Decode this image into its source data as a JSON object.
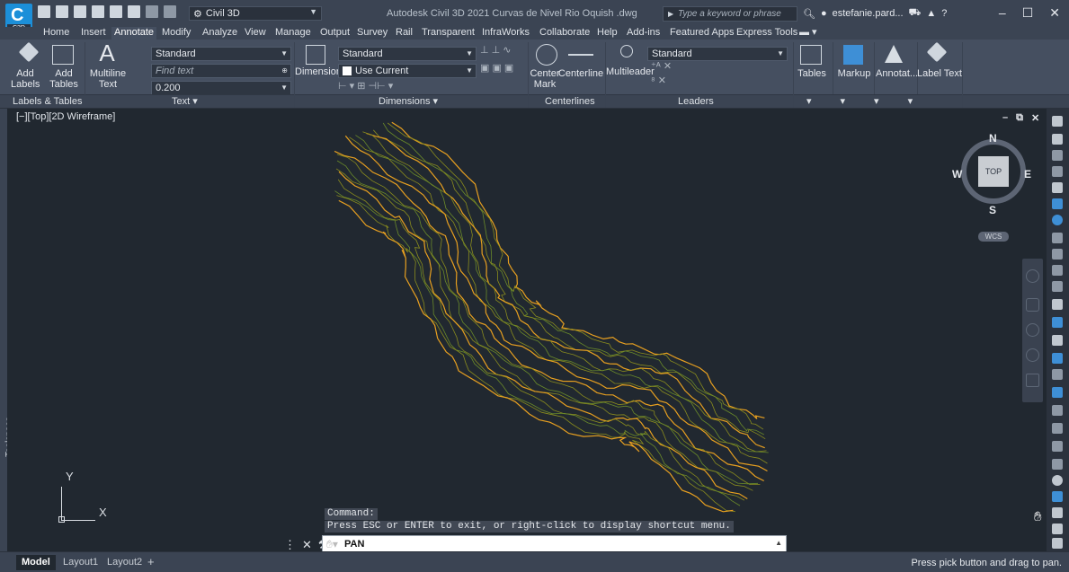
{
  "app": {
    "logo_text": "C",
    "logo_sub": "C3D",
    "workspace": "Civil 3D",
    "title": "Autodesk Civil 3D 2021   Curvas de Nivel Rio Oquish .dwg",
    "search_placeholder": "Type a keyword or phrase",
    "user": "estefanie.pard..."
  },
  "tabs": [
    "Home",
    "Insert",
    "Annotate",
    "Modify",
    "Analyze",
    "View",
    "Manage",
    "Output",
    "Survey",
    "Rail",
    "Transparent",
    "InfraWorks",
    "Collaborate",
    "Help",
    "Add-ins",
    "Featured Apps",
    "Express Tools"
  ],
  "active_tab": "Annotate",
  "ribbon": {
    "labels_tables": {
      "add_labels": "Add Labels",
      "add_tables": "Add Tables",
      "footer": "Labels & Tables"
    },
    "text": {
      "multiline": "Multiline Text",
      "style": "Standard",
      "find_placeholder": "Find text",
      "height": "0.200",
      "footer": "Text"
    },
    "dimensions": {
      "dimension": "Dimension",
      "style": "Standard",
      "layer": "Use Current",
      "footer": "Dimensions"
    },
    "centerlines": {
      "center_mark": "Center Mark",
      "centerline": "Centerline",
      "footer": "Centerlines"
    },
    "leaders": {
      "multileader": "Multileader",
      "style": "Standard",
      "footer": "Leaders"
    },
    "tables": "Tables",
    "markup": "Markup",
    "annotate": "Annotat...",
    "label_text": "Label Text"
  },
  "viewport": {
    "label": "[−][Top][2D Wireframe]",
    "toolspace": "Toolspace",
    "compass": {
      "n": "N",
      "s": "S",
      "e": "E",
      "w": "W",
      "top": "TOP",
      "wcs": "WCS"
    },
    "ucs_x": "X",
    "ucs_y": "Y"
  },
  "command": {
    "history_1": "Command:",
    "history_2": "Press ESC or ENTER to exit, or right-click to display shortcut menu.",
    "current": "PAN"
  },
  "status": {
    "layouts": [
      "Model",
      "Layout1",
      "Layout2"
    ],
    "add": "+",
    "message": "Press pick button and drag to pan."
  },
  "colors": {
    "contour_major": "#e8a020",
    "contour_minor": "#8a8c1e",
    "contour_green": "#6a8a2a",
    "background": "#212830"
  }
}
